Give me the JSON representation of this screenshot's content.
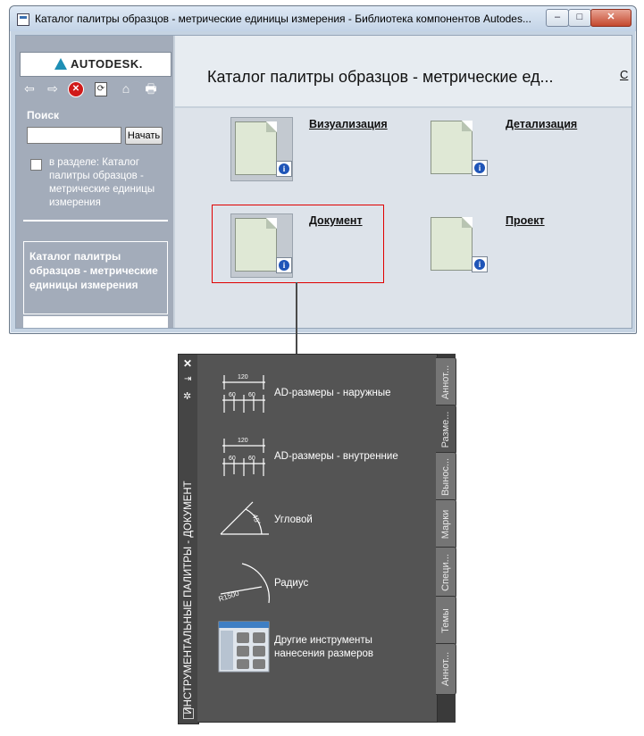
{
  "window": {
    "title": "Каталог палитры образцов - метрические единицы измерения - Библиотека компонентов Autodes...",
    "controls": {
      "minimize": "–",
      "maximize": "□",
      "close": "✕"
    }
  },
  "left_pane": {
    "logo_text": "AUTODESK.",
    "toolbar_icons": [
      "back-arrow-icon",
      "forward-arrow-icon",
      "stop-icon",
      "refresh-icon",
      "home-icon",
      "print-icon"
    ],
    "search": {
      "label": "Поиск",
      "value": "",
      "button": "Начать"
    },
    "in_section": "в разделе: Каталог палитры образцов - метрические единицы измерения",
    "nav_title": "Каталог палитры образцов - метрические единицы измерения"
  },
  "right_pane": {
    "title": "Каталог палитры образцов - метрические ед...",
    "more": "С",
    "items": [
      {
        "label": "Визуализация"
      },
      {
        "label": "Детализация"
      },
      {
        "label": "Документ"
      },
      {
        "label": "Проект"
      }
    ]
  },
  "palette": {
    "title": "ИНСТРУМЕНТАЛЬНЫЕ ПАЛИТРЫ - ДОКУМЕНТ",
    "tabs": [
      "Аннот...",
      "Разме...",
      "Вынос...",
      "Марки",
      "Специ...",
      "Темы",
      "Аннот..."
    ],
    "active_tab": "Разме...",
    "tools": [
      {
        "label": "AD-размеры - наружные",
        "dims": [
          "120",
          "60",
          "60"
        ]
      },
      {
        "label": "AD-размеры - внутренние",
        "dims": [
          "120",
          "60",
          "60"
        ]
      },
      {
        "label": "Угловой",
        "dims": [
          "45°"
        ]
      },
      {
        "label": "Радиус",
        "dims": [
          "R1500"
        ]
      },
      {
        "label_line1": "Другие инструменты",
        "label_line2": "нанесения размеров"
      }
    ]
  }
}
